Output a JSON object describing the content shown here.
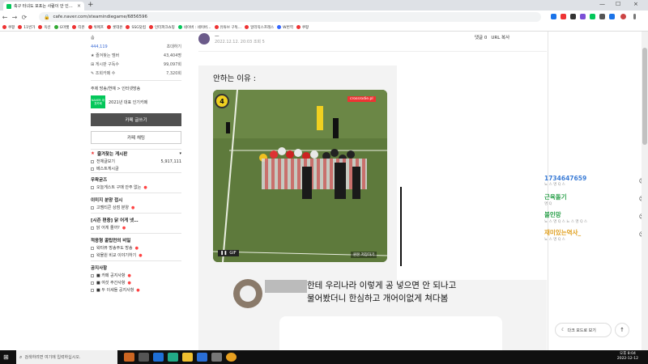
{
  "browser": {
    "tab_title": "축구 터녀도 포포는 사람이 안 인…",
    "tab_close": "×",
    "new_tab": "+",
    "minimize": "—",
    "maximize": "☐",
    "close": "×",
    "url": "cafe.naver.com/steamindiegame/6856596",
    "back": "←",
    "forward": "→",
    "reload": "⟳",
    "lock": "🔒"
  },
  "bookmarks": [
    {
      "label": "쿠팡",
      "color": "#e33"
    },
    {
      "label": "11번가",
      "color": "#e33"
    },
    {
      "label": "옥션",
      "color": "#e33"
    },
    {
      "label": "G마켓",
      "color": "#3a3"
    },
    {
      "label": "티몬",
      "color": "#e33"
    },
    {
      "label": "위메프",
      "color": "#e33"
    },
    {
      "label": "롯데온",
      "color": "#e33"
    },
    {
      "label": "SSG닷컴",
      "color": "#e33"
    },
    {
      "label": "인터파크쇼핑",
      "color": "#e33"
    },
    {
      "label": "네이버 : 네이버…",
      "color": "#03c75a"
    },
    {
      "label": "유튜브 구독…",
      "color": "#e33"
    },
    {
      "label": "알리익스프레스",
      "color": "#e33"
    },
    {
      "label": "W번역",
      "color": "#36f"
    },
    {
      "label": "쿠팡",
      "color": "#e33"
    }
  ],
  "sidebar": {
    "stats": [
      {
        "label": "★ 즐겨찾는 멤버",
        "value": "43,404명"
      },
      {
        "label": "⊞ 게시판 구독수",
        "value": "99,097회"
      },
      {
        "label": "✎ 조회카페 수",
        "value": "7,320회"
      }
    ],
    "member_label": "솜",
    "member_count": "444,119",
    "invite": "초대하기",
    "theme_info": "주제 방송/연예 > 인터넷방송",
    "badge_text": "NAVER 대표카페",
    "badge_title": "2021년 대표 인기카페",
    "write_button": "카페 글쓰기",
    "chat_button": "카페 채팅",
    "fav_header": "즐겨찾는 게시판",
    "all_posts": "전체글보기",
    "all_posts_count": "5,917,111",
    "popular": "베스트게시글",
    "sections": [
      {
        "title": "우왁굳즈",
        "items": [
          "오늘게스트 구매 안주 없는"
        ]
      },
      {
        "title": "이미지 분양 접시",
        "items": [
          "고멤티콘 상점 분양"
        ]
      },
      {
        "title": "[시즌 편중] 닭 어게 넷…",
        "items": [
          "닭 어게 줄까?"
        ]
      },
      {
        "title": "적응형 꿀팁먼의 비밀",
        "items": [
          "왁타뷰 방송주도 방송",
          "왁물원 비교 이야기하기"
        ]
      },
      {
        "title": "공지사항",
        "items": [
          "■ 카페 공지사항",
          "■ 여섯 주간사항",
          "■ 두 이세돌 공지사항"
        ]
      }
    ]
  },
  "post": {
    "author": "—",
    "date": "2022.12.12. 20:03",
    "views": "조회 5",
    "comments": "댓글 0",
    "url_copy": "URL 복사",
    "title": "안하는 이유 :",
    "video_number": "4",
    "video_watermark": "crossrodie.pl",
    "gif_label": "GIF",
    "pause": "❚❚",
    "original": "원본 저장하기",
    "comment_line1": "한테 우리나라 이렇게 공 넣으면 안 되나고",
    "comment_line2": "물어봤더니 한심하고 개어이없게 쳐다봄"
  },
  "right_panel": {
    "chats": [
      {
        "name": "1734647659",
        "sub": "뇨 스 명 Q 스",
        "color": "#3b7cd6"
      },
      {
        "name": "근육돌기",
        "sub": "명 Q",
        "color": "#2aa04a"
      },
      {
        "name": "불인망",
        "sub": "뇨 스 명 Q 스 뇨 스 명 Q 스",
        "color": "#2aa04a"
      },
      {
        "name": "재미있는역사_",
        "sub": "뇨 스 명 Q 스",
        "color": "#e0a020"
      }
    ],
    "dark_mode": "다크 모드로 보기",
    "top": "↑"
  },
  "taskbar": {
    "search_placeholder": "검색하려면 여기에 입력하십시오.",
    "time": "오후 8:04",
    "date": "2022-12-12"
  }
}
